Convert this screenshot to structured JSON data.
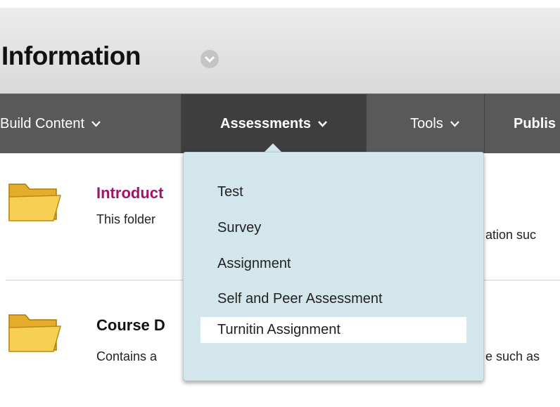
{
  "page": {
    "title": "Information"
  },
  "toolbar": {
    "items": [
      {
        "label": "Build Content"
      },
      {
        "label": "Assessments"
      },
      {
        "label": "Tools"
      },
      {
        "label": "Publis"
      }
    ]
  },
  "content": {
    "items": [
      {
        "title": "Introduct",
        "description": "This folder",
        "description_tail": "ation suc",
        "title_color": "#a0146c"
      },
      {
        "title": "Course D",
        "description": "Contains a",
        "description_tail": "e such as",
        "title_color": "#111111"
      }
    ]
  },
  "dropdown": {
    "items": [
      {
        "label": "Test"
      },
      {
        "label": "Survey"
      },
      {
        "label": "Assignment"
      },
      {
        "label": "Self and Peer Assessment"
      },
      {
        "label": "Turnitin Assignment"
      }
    ],
    "highlighted_item": "Turnitin Assignment"
  },
  "icons": {
    "title": "chevron-down-circle-icon",
    "toolbar": "chevron-down-icon",
    "content": "folder-icon"
  },
  "colors": {
    "toolbar": "#595959",
    "toolbar_active": "#3e3e3e",
    "dropdown": "#d3e6ec",
    "link": "#a0146c"
  }
}
